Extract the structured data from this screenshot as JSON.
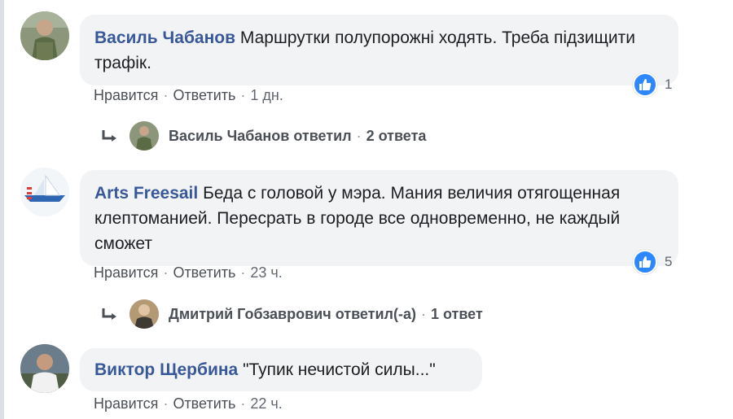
{
  "comments": [
    {
      "author": "Василь Чабанов",
      "text": "Маршрутки полупорожні ходять. Треба підзищити трафік.",
      "actions": {
        "like": "Нравится",
        "reply": "Ответить",
        "time": "1 дн."
      },
      "reaction_count": "1",
      "reply_summary": {
        "author": "Василь Чабанов",
        "verb": "ответил",
        "count": "2 ответа"
      }
    },
    {
      "author": "Arts Freesail",
      "text": "Беда с головой у мэра. Мания величия отягощенная клептоманией. Пересрать в городе все одновременно, не каждый сможет",
      "actions": {
        "like": "Нравится",
        "reply": "Ответить",
        "time": "23 ч."
      },
      "reaction_count": "5",
      "reply_summary": {
        "author": "Дмитрий Гобзаврович",
        "verb": "ответил(-а)",
        "count": "1 ответ"
      }
    },
    {
      "author": "Виктор Щербина",
      "text": "\"Тупик нечистой силы...\"",
      "actions": {
        "like": "Нравится",
        "reply": "Ответить",
        "time": "22 ч."
      }
    }
  ],
  "colors": {
    "author": "#385898",
    "bubble": "#f2f3f5",
    "like_blue": "#2d88ff",
    "meta": "#606770"
  },
  "icons": [
    "like-icon",
    "reply-arrow-icon"
  ]
}
